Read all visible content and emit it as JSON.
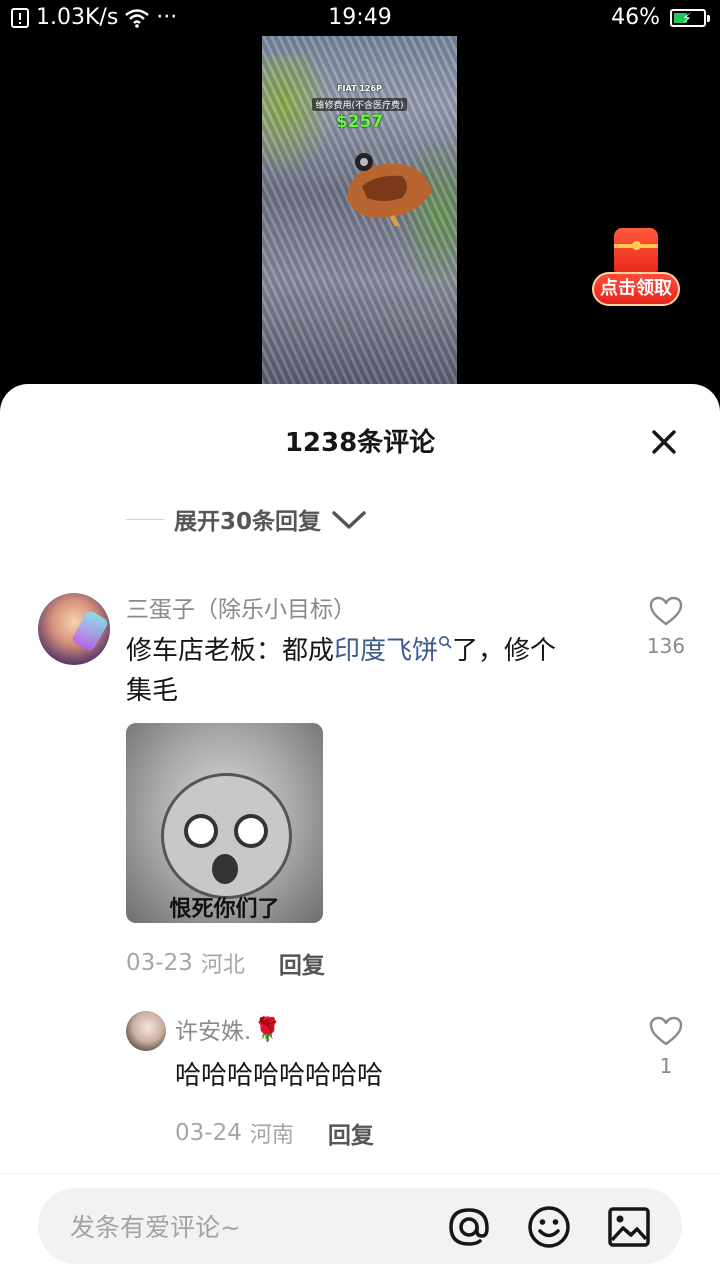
{
  "status_bar": {
    "speed": "1.03K/s",
    "more": "···",
    "time": "19:49",
    "battery": "46%",
    "battery_level": 0.46
  },
  "video": {
    "car_name": "FIAT 126P",
    "repair_label": "维修费用(不含医疗费)",
    "repair_cost": "$257"
  },
  "red_packet": {
    "label": "点击领取"
  },
  "comments_sheet": {
    "title": "1238条评论",
    "expand_replies": "展开30条回复",
    "comment": {
      "username": "三蛋子（除乐小目标）",
      "text_before": "修车店老板：都成",
      "highlight": "印度飞饼",
      "text_after": "了，修个集毛",
      "meme_caption": "恨死你们了",
      "date": "03-23",
      "location": "河北",
      "reply_label": "回复",
      "like_count": "136"
    },
    "reply": {
      "username": "许安姝.",
      "emoji": "🌹",
      "text": "哈哈哈哈哈哈哈哈",
      "date": "03-24",
      "location": "河南",
      "reply_label": "回复",
      "like_count": "1"
    }
  },
  "input_bar": {
    "placeholder": "发条有爱评论~",
    "icons": [
      "at-icon",
      "emoji-icon",
      "image-icon"
    ]
  }
}
